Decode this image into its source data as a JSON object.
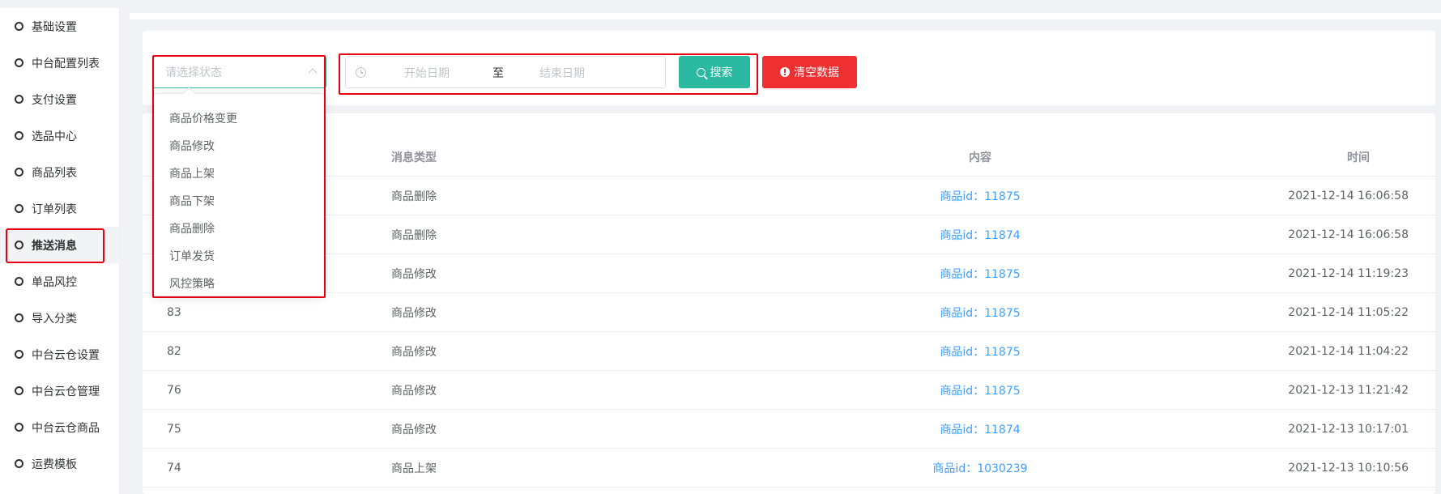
{
  "sidebar": {
    "items": [
      {
        "label": "基础设置"
      },
      {
        "label": "中台配置列表"
      },
      {
        "label": "支付设置"
      },
      {
        "label": "选品中心"
      },
      {
        "label": "商品列表"
      },
      {
        "label": "订单列表"
      },
      {
        "label": "推送消息",
        "active": true
      },
      {
        "label": "单品风控"
      },
      {
        "label": "导入分类"
      },
      {
        "label": "中台云仓设置"
      },
      {
        "label": "中台云仓管理"
      },
      {
        "label": "中台云仓商品"
      },
      {
        "label": "运费模板"
      }
    ]
  },
  "filters": {
    "status_placeholder": "请选择状态",
    "status_options": [
      "商品价格变更",
      "商品修改",
      "商品上架",
      "商品下架",
      "商品删除",
      "订单发货",
      "风控策略"
    ],
    "date_start_placeholder": "开始日期",
    "date_separator": "至",
    "date_end_placeholder": "结束日期",
    "search_label": "搜索",
    "clear_label": "清空数据"
  },
  "table": {
    "headers": {
      "type": "消息类型",
      "content": "内容",
      "time": "时间"
    },
    "rows": [
      {
        "id": "",
        "type": "商品删除",
        "content": "商品id：11875",
        "time": "2021-12-14 16:06:58"
      },
      {
        "id": "",
        "type": "商品删除",
        "content": "商品id：11874",
        "time": "2021-12-14 16:06:58"
      },
      {
        "id": "",
        "type": "商品修改",
        "content": "商品id：11875",
        "time": "2021-12-14 11:19:23"
      },
      {
        "id": "83",
        "type": "商品修改",
        "content": "商品id：11875",
        "time": "2021-12-14 11:05:22"
      },
      {
        "id": "82",
        "type": "商品修改",
        "content": "商品id：11875",
        "time": "2021-12-14 11:04:22"
      },
      {
        "id": "76",
        "type": "商品修改",
        "content": "商品id：11875",
        "time": "2021-12-13 11:21:42"
      },
      {
        "id": "75",
        "type": "商品修改",
        "content": "商品id：11874",
        "time": "2021-12-13 10:17:01"
      },
      {
        "id": "74",
        "type": "商品上架",
        "content": "商品id：1030239",
        "time": "2021-12-13 10:10:56"
      }
    ]
  },
  "colors": {
    "accent": "#2bb9a1",
    "danger": "#ee3033",
    "highlight": "#e60012",
    "link": "#409eff"
  }
}
